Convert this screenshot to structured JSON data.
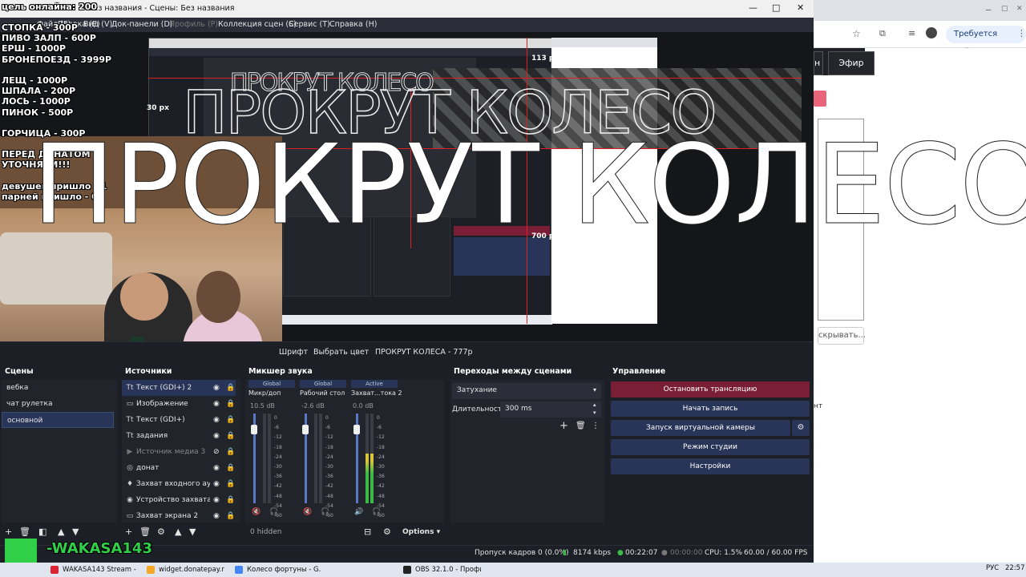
{
  "window": {
    "title": "Без названия - Сцены: Без названия",
    "minimize": "—",
    "maximize": "□",
    "close": "✕"
  },
  "menu": [
    "Файл (F)",
    "Правка (E)",
    "Вид (V)",
    "Док-панели (D)",
    "Профиль (P)",
    "Коллекция сцен (S)",
    "Сервис (T)",
    "Справка (H)"
  ],
  "overlay": {
    "goal": "цель онлайна: 200",
    "list1": "СТОПКА - 300Р\nПИВО ЗАЛП - 600Р\nЕРШ - 1000Р\nБРОНЕПОЕЗД - 3999Р",
    "list2": "ЛЕЩ - 1000Р\nШПАЛА - 200Р\nЛОСЬ - 1000Р\nПИНОК - 500Р",
    "list3": "ГОРЧИЦА - 300Р",
    "list4": "ПЕРЕД ДОНАТОМ\nУТОЧНЯЕМ!!!",
    "list5": "девушек пришло - 1\nпарней пришло - 0",
    "big_text": "ПРОКРУТ КОЛЕСО",
    "px_label_1": "113 px",
    "px_label_2": "700 px",
    "px_label_3": "30 px"
  },
  "filterbar": {
    "font_btn": "Шрифт",
    "color_btn": "Выбрать цвет",
    "source_name": "ПРОКРУТ КОЛЕСА - 777р"
  },
  "scenes": {
    "title": "Сцены",
    "items": [
      "вебка",
      "чат рулетка",
      "основной"
    ]
  },
  "sources": {
    "title": "Источники",
    "items": [
      {
        "icon": "text-icon",
        "glyph": "Tt",
        "label": "Текст (GDI+) 2"
      },
      {
        "icon": "image-icon",
        "glyph": "▭",
        "label": "Изображение"
      },
      {
        "icon": "text-icon",
        "glyph": "Tt",
        "label": "Текст (GDI+)"
      },
      {
        "icon": "text-icon",
        "glyph": "Tt",
        "label": "задания"
      },
      {
        "icon": "media-icon",
        "glyph": "▶",
        "label": "Источник медиа 3"
      },
      {
        "icon": "browser-icon",
        "glyph": "◎",
        "label": "донат"
      },
      {
        "icon": "mic-icon",
        "glyph": "♦",
        "label": "Захват входного аудио"
      },
      {
        "icon": "camera-icon",
        "glyph": "◉",
        "label": "Устройство захвата видео"
      },
      {
        "icon": "monitor-icon",
        "glyph": "▭",
        "label": "Захват экрана 2"
      }
    ]
  },
  "mixer": {
    "title": "Микшер звука",
    "hidden_label": "0 hidden",
    "options_label": "Options",
    "channels": [
      {
        "tag": "Global",
        "name": "Микр/доп",
        "db": "10.5 dB",
        "level": 0.0,
        "muted": true
      },
      {
        "tag": "Global",
        "name": "Рабочий стол",
        "db": "-2.6 dB",
        "level": 0.0,
        "muted": true
      },
      {
        "tag": "Active",
        "name": "Захват...тока 2",
        "db": "0.0 dB",
        "level": 0.55,
        "muted": false
      }
    ],
    "scale": [
      "0",
      "-6",
      "-12",
      "-18",
      "-24",
      "-30",
      "-36",
      "-42",
      "-48",
      "-54",
      "-60"
    ]
  },
  "transitions": {
    "title": "Переходы между сценами",
    "selected": "Затухание",
    "duration_label": "Длительность",
    "duration_value": "300 ms"
  },
  "controls": {
    "title": "Управление",
    "stop_stream": "Остановить трансляцию",
    "start_record": "Начать запись",
    "virtual_cam": "Запуск виртуальной камеры",
    "studio_mode": "Режим студии",
    "settings": "Настройки"
  },
  "status": {
    "dropped": "Пропуск кадров 0 (0.0%)",
    "bitrate": "8174 kbps",
    "stream_time": "00:22:07",
    "rec_time": "00:00:00",
    "cpu": "CPU: 1.5%",
    "fps": "60.00 / 60.00 FPS"
  },
  "browser": {
    "required_action": "Требуется действие",
    "efir": "Эфир",
    "hide": "скрывать...",
    "cut_letter": "нт"
  },
  "stream_brand": "-WAKASA143",
  "taskbar": {
    "tasks": [
      {
        "label": "WAKASA143 Stream - ...",
        "color": "#d23"
      },
      {
        "label": "widget.donatepay.ru/...",
        "color": "#f5a623"
      },
      {
        "label": "Колесо фортуны - G...",
        "color": "#4285f4"
      },
      {
        "label": "OBS 32.1.0 - Профил...",
        "color": "#222"
      }
    ],
    "lang": "РУС",
    "time": "22:57"
  }
}
